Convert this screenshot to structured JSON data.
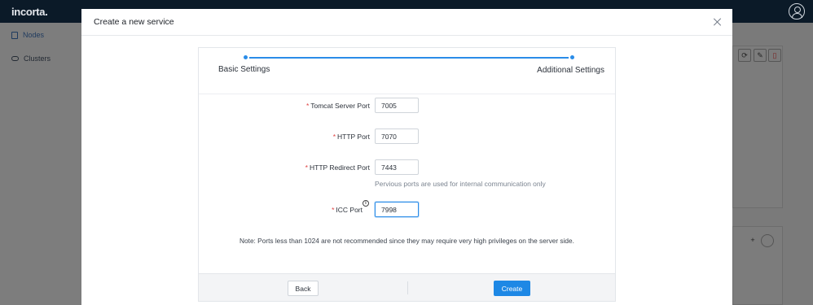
{
  "app": {
    "logo": "incorta.",
    "sidebar": {
      "items": [
        {
          "label": "Nodes"
        },
        {
          "label": "Clusters"
        }
      ]
    }
  },
  "modal": {
    "title": "Create a new service",
    "steps": [
      {
        "label": "Basic Settings"
      },
      {
        "label": "Additional Settings"
      }
    ],
    "fields": {
      "tomcat": {
        "label": "Tomcat Server Port",
        "value": "7005"
      },
      "http": {
        "label": "HTTP Port",
        "value": "7070"
      },
      "redirect": {
        "label": "HTTP Redirect Port",
        "value": "7443"
      },
      "ports_hint": "Pervious ports are used for internal communication only",
      "icc": {
        "label": "ICC Port",
        "value": "7998"
      }
    },
    "required_mark": "*",
    "info_glyph": "i",
    "note": "Note: Ports less than 1024 are not recommended since they may require very high privileges on the server side.",
    "buttons": {
      "back": "Back",
      "create": "Create"
    }
  },
  "background_buttons": {
    "add": "+"
  },
  "colors": {
    "accent": "#1e88e5",
    "required": "#e04141",
    "topbar": "#0b1a28"
  }
}
